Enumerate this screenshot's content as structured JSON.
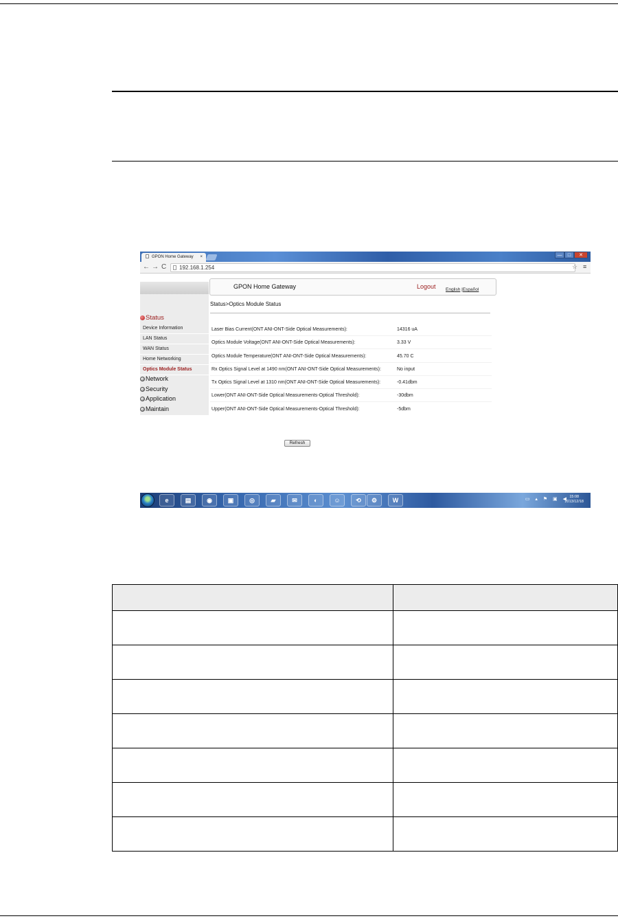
{
  "browser": {
    "tab_title": "GPON Home Gateway",
    "tab_close": "×",
    "url": "192.168.1.254",
    "window_buttons": [
      "—",
      "□",
      "✕"
    ]
  },
  "gateway": {
    "title": "GPON Home Gateway",
    "logout": "Logout",
    "lang_english": "English",
    "lang_sep": "|",
    "lang_espanol": "Español",
    "breadcrumb": "Status>Optics Module Status",
    "refresh": "Refresh"
  },
  "sidebar": {
    "status": "Status",
    "status_items": [
      "Device Information",
      "LAN Status",
      "WAN Status",
      "Home Networking",
      "Optics Module Status"
    ],
    "other_menus": [
      "Network",
      "Security",
      "Application",
      "Maintain"
    ]
  },
  "optics": [
    {
      "label": "Laser Bias Current(ONT ANI-ONT-Side Optical Measurements):",
      "value": "14316 uA"
    },
    {
      "label": "Optics Module Voltage(ONT ANI-ONT-Side Optical Measurements):",
      "value": "3.33 V"
    },
    {
      "label": "Optics Module Temperature(ONT ANI-ONT-Side Optical Measurements):",
      "value": "45.70 C"
    },
    {
      "label": "Rx Optics Signal Level at 1490 nm(ONT ANI-ONT-Side Optical Measurements):",
      "value": "No input"
    },
    {
      "label": "Tx Optics Signal Level at 1310 nm(ONT ANI-ONT-Side Optical Measurements):",
      "value": "-0.41dbm"
    },
    {
      "label": "Lower(ONT ANI-ONT-Side Optical Measurements-Optical Threshold):",
      "value": "-30dbm"
    },
    {
      "label": "Upper(ONT ANI-ONT-Side Optical Measurements-Optical Threshold):",
      "value": "-5dbm"
    }
  ],
  "taskbar": {
    "icons": [
      "ie-icon",
      "folder-icon",
      "firefox-icon",
      "media-icon",
      "chrome-icon",
      "book-icon",
      "outlook-icon",
      "globe-icon",
      "user-icon",
      "sync-icon",
      "tool-icon",
      "word-icon"
    ],
    "word_letter": "W",
    "time": "15:08",
    "date": "2013/12/18"
  },
  "doc_table": {
    "rows": 8,
    "cols": 2
  }
}
